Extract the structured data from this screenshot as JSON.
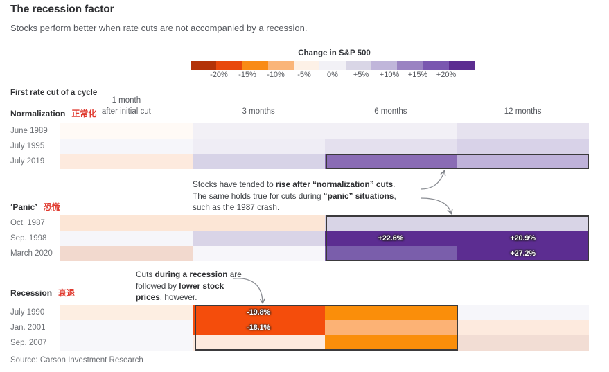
{
  "header": {
    "title": "The recession factor",
    "subtitle": "Stocks perform better when rate cuts are not accompanied by a recession."
  },
  "legend": {
    "title": "Change in S&P 500",
    "ticks": [
      "-20%",
      "-15%",
      "-10%",
      "-5%",
      "0%",
      "+5%",
      "+10%",
      "+15%",
      "+20%"
    ],
    "colors": [
      "#b33208",
      "#e8480c",
      "#f98b16",
      "#fab579",
      "#fdf1e7",
      "#f2f1f6",
      "#d9d6e6",
      "#c0b6da",
      "#9a83c2",
      "#7a57b0",
      "#5c2d91"
    ]
  },
  "table": {
    "corner_header": "First rate cut of a cycle",
    "columns": [
      {
        "label_line1": "1 month",
        "label_line2": "after initial cut"
      },
      {
        "label_line1": "3 months",
        "label_line2": ""
      },
      {
        "label_line1": "6 months",
        "label_line2": ""
      },
      {
        "label_line1": "12 months",
        "label_line2": ""
      }
    ]
  },
  "sections": [
    {
      "name": "Normalization",
      "name_cn": "正常化",
      "rows": [
        {
          "label": "June 1989",
          "cells": [
            {
              "color": "#fffaf6",
              "value": ""
            },
            {
              "color": "#f2f0f6",
              "value": ""
            },
            {
              "color": "#f2f0f6",
              "value": ""
            },
            {
              "color": "#e6e2ef",
              "value": ""
            }
          ]
        },
        {
          "label": "July 1995",
          "cells": [
            {
              "color": "#f6f6fa",
              "value": ""
            },
            {
              "color": "#efedf5",
              "value": ""
            },
            {
              "color": "#e4e0ee",
              "value": ""
            },
            {
              "color": "#d8d2e8",
              "value": ""
            }
          ]
        },
        {
          "label": "July 2019",
          "cells": [
            {
              "color": "#fdeade",
              "value": ""
            },
            {
              "color": "#d7d3e7",
              "value": ""
            },
            {
              "color": "#8a6cb5",
              "value": ""
            },
            {
              "color": "#bfb2da",
              "value": ""
            }
          ]
        }
      ]
    },
    {
      "name": "‘Panic’",
      "name_cn": "恐慌",
      "rows": [
        {
          "label": "Oct. 1987",
          "cells": [
            {
              "color": "#fce6d6",
              "value": ""
            },
            {
              "color": "#fce6d6",
              "value": ""
            },
            {
              "color": "#d8d4e6",
              "value": ""
            },
            {
              "color": "#d8d4e6",
              "value": ""
            }
          ]
        },
        {
          "label": "Sep. 1998",
          "cells": [
            {
              "color": "#f6f6fa",
              "value": ""
            },
            {
              "color": "#d9d4e7",
              "value": ""
            },
            {
              "color": "#5c2d91",
              "value": "+22.6%"
            },
            {
              "color": "#5c2d91",
              "value": "+20.9%"
            }
          ]
        },
        {
          "label": "March 2020",
          "cells": [
            {
              "color": "#f2d9ce",
              "value": ""
            },
            {
              "color": "#f7f6fa",
              "value": ""
            },
            {
              "color": "#7a5eab",
              "value": ""
            },
            {
              "color": "#5c2d91",
              "value": "+27.2%"
            }
          ]
        }
      ]
    },
    {
      "name": "Recession",
      "name_cn": "衰退",
      "rows": [
        {
          "label": "July 1990",
          "cells": [
            {
              "color": "#fdeee2",
              "value": ""
            },
            {
              "color": "#f44d0c",
              "value": "-19.8%"
            },
            {
              "color": "#fa8e0a",
              "value": ""
            },
            {
              "color": "#f6f6fa",
              "value": ""
            }
          ]
        },
        {
          "label": "Jan. 2001",
          "cells": [
            {
              "color": "#f7f7fa",
              "value": ""
            },
            {
              "color": "#f44d0c",
              "value": "-18.1%"
            },
            {
              "color": "#fcb275",
              "value": ""
            },
            {
              "color": "#fdeade",
              "value": ""
            }
          ]
        },
        {
          "label": "Sep. 2007",
          "cells": [
            {
              "color": "#f7f7fa",
              "value": ""
            },
            {
              "color": "#fdeade",
              "value": ""
            },
            {
              "color": "#fa8e0a",
              "value": ""
            },
            {
              "color": "#f2ddd4",
              "value": ""
            }
          ]
        }
      ]
    }
  ],
  "annotations": [
    {
      "id": "note-normalization",
      "lines": [
        [
          {
            "t": "Stocks have tended to ",
            "b": false
          },
          {
            "t": "rise after “normalization” cuts",
            "b": true
          },
          {
            "t": ".",
            "b": false
          }
        ],
        [
          {
            "t": "The same holds true for cuts during ",
            "b": false
          },
          {
            "t": "“panic” situations",
            "b": true
          },
          {
            "t": ",",
            "b": false
          }
        ],
        [
          {
            "t": "such as the 1987 crash.",
            "b": false
          }
        ]
      ]
    },
    {
      "id": "note-recession",
      "lines": [
        [
          {
            "t": "Cuts ",
            "b": false
          },
          {
            "t": "during a recession",
            "b": true
          },
          {
            "t": " are",
            "b": false
          }
        ],
        [
          {
            "t": "followed by ",
            "b": false
          },
          {
            "t": "lower stock",
            "b": true
          }
        ],
        [
          {
            "t": "prices",
            "b": true
          },
          {
            "t": ", however.",
            "b": false
          }
        ]
      ]
    }
  ],
  "source": "Source: Carson Investment Research"
}
